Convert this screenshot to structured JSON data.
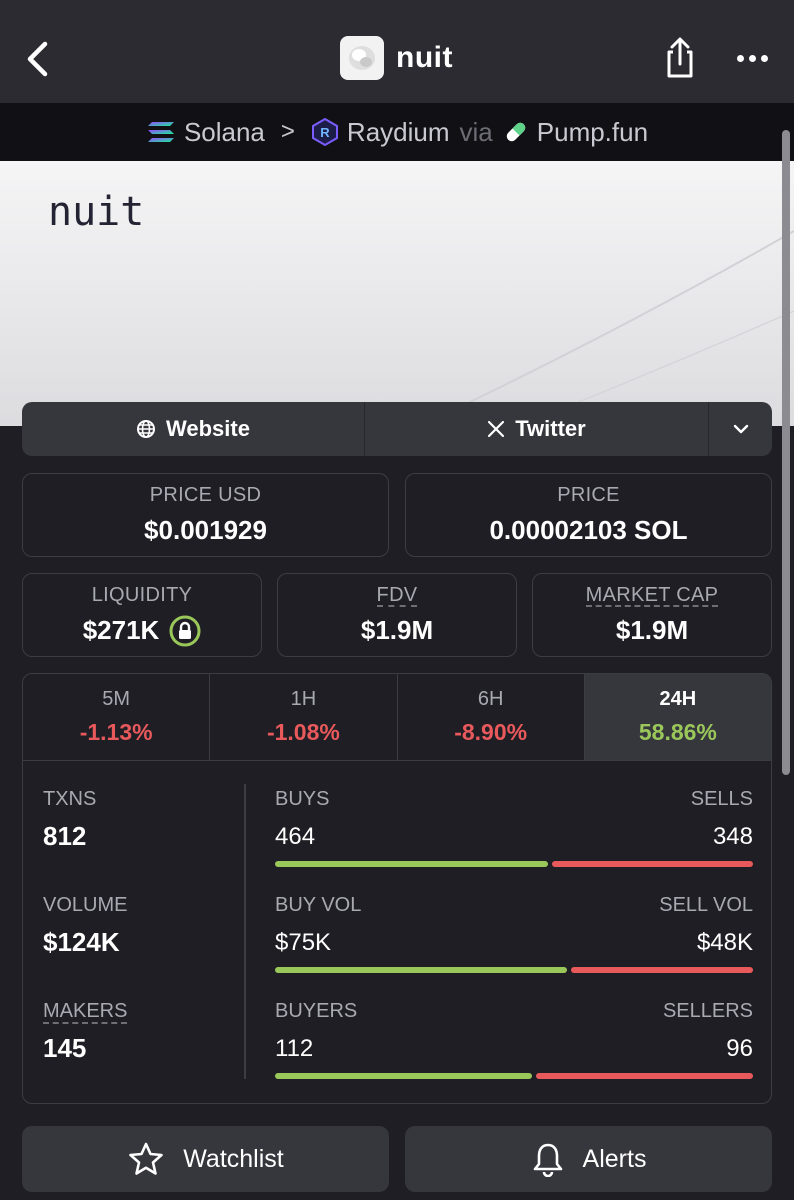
{
  "header": {
    "title": "nuit"
  },
  "breadcrumb": {
    "chain": "Solana",
    "separator": ">",
    "dex": "Raydium",
    "via": "via",
    "launchpad": "Pump.fun"
  },
  "banner": {
    "text": "nuit"
  },
  "links": {
    "website": "Website",
    "twitter": "Twitter"
  },
  "stats": {
    "price_usd": {
      "label": "PRICE USD",
      "value": "$0.001929"
    },
    "price_native": {
      "label": "PRICE",
      "value": "0.00002103 SOL"
    },
    "liquidity": {
      "label": "LIQUIDITY",
      "value": "$271K"
    },
    "fdv": {
      "label": "FDV",
      "value": "$1.9M"
    },
    "market_cap": {
      "label": "MARKET CAP",
      "value": "$1.9M"
    }
  },
  "timeframes": [
    {
      "label": "5M",
      "change": "-1.13%",
      "active": false
    },
    {
      "label": "1H",
      "change": "-1.08%",
      "active": false
    },
    {
      "label": "6H",
      "change": "-8.90%",
      "active": false
    },
    {
      "label": "24H",
      "change": "58.86%",
      "active": true
    }
  ],
  "activity": {
    "txns": {
      "label": "TXNS",
      "value": "812"
    },
    "volume": {
      "label": "VOLUME",
      "value": "$124K"
    },
    "makers": {
      "label": "MAKERS",
      "value": "145"
    },
    "buys": {
      "label": "BUYS",
      "value": "464",
      "fraction": 0.571
    },
    "sells": {
      "label": "SELLS",
      "value": "348"
    },
    "buy_vol": {
      "label": "BUY VOL",
      "value": "$75K",
      "fraction": 0.61
    },
    "sell_vol": {
      "label": "SELL VOL",
      "value": "$48K"
    },
    "buyers": {
      "label": "BUYERS",
      "value": "112",
      "fraction": 0.538
    },
    "sellers": {
      "label": "SELLERS",
      "value": "96"
    }
  },
  "actions": {
    "watchlist": "Watchlist",
    "alerts": "Alerts"
  },
  "colors": {
    "positive": "#9ac75a",
    "negative": "#e8595c",
    "background": "#1e1e24"
  }
}
